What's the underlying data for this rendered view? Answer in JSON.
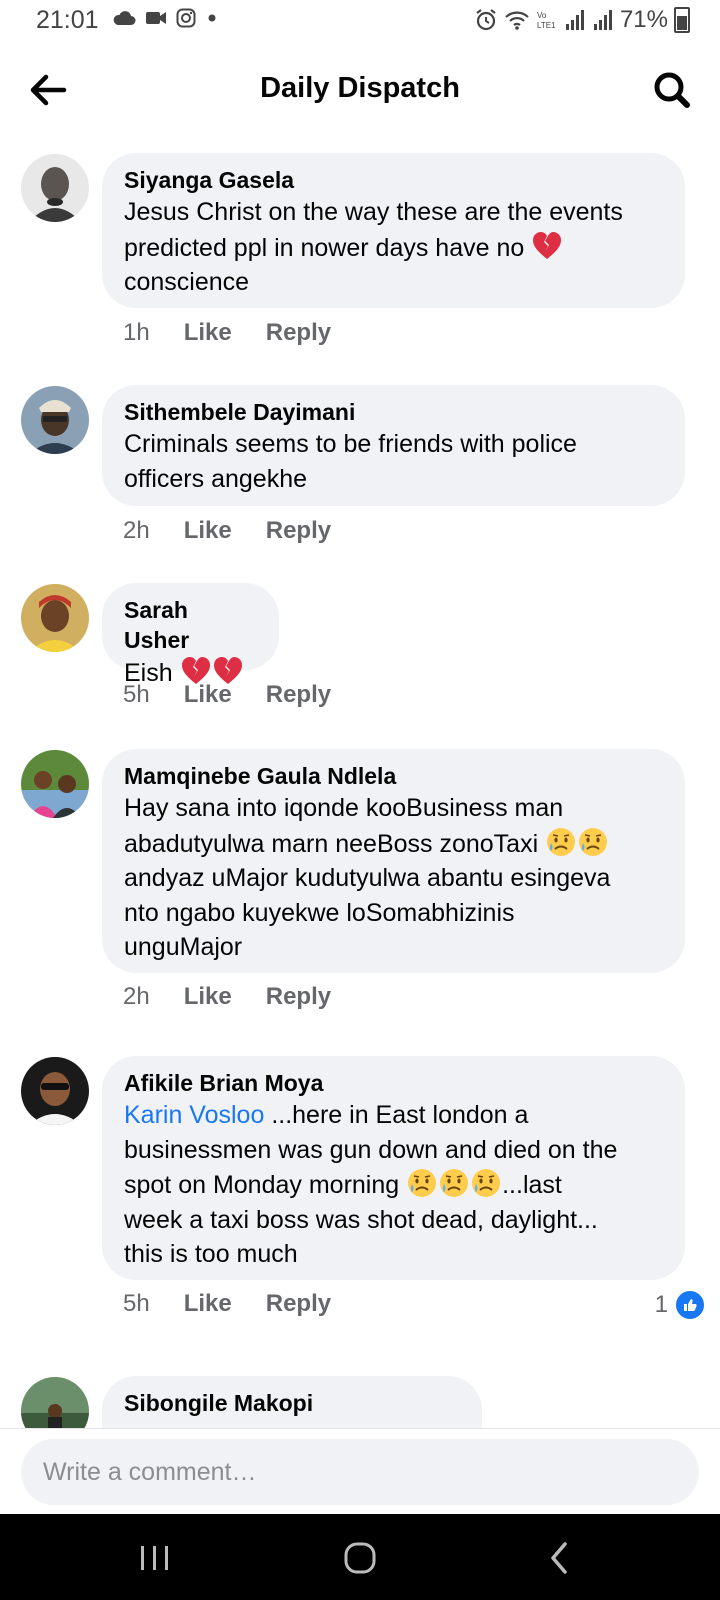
{
  "status_bar": {
    "time": "21:01",
    "battery": "71%",
    "icons_left": [
      "cloud-icon",
      "video-camera-icon",
      "instagram-icon",
      "dot-icon"
    ],
    "icons_right": [
      "alarm-icon",
      "wifi-icon",
      "volte-icon",
      "signal-icon",
      "signal-icon",
      "battery-icon"
    ]
  },
  "header": {
    "title": "Daily Dispatch",
    "back_icon": "arrow-left-icon",
    "search_icon": "search-icon"
  },
  "comments": [
    {
      "author": "Siyanga Gasela",
      "lines": [
        "Jesus Christ on the way these are the events",
        "predicted ppl in nower days have no",
        "conscience"
      ],
      "emoji_after_line2": "broken-heart",
      "time": "1h",
      "like_label": "Like",
      "reply_label": "Reply"
    },
    {
      "author": "Sithembele Dayimani",
      "lines": [
        "Criminals seems to be friends with police",
        "officers angekhe"
      ],
      "time": "2h",
      "like_label": "Like",
      "reply_label": "Reply"
    },
    {
      "author": "Sarah Usher",
      "lines": [
        "Eish"
      ],
      "emoji_after_line1": "broken-heart x2",
      "time": "5h",
      "like_label": "Like",
      "reply_label": "Reply"
    },
    {
      "author": "Mamqinebe Gaula Ndlela",
      "lines": [
        "Hay sana into iqonde kooBusiness man",
        "abadutyulwa marn neeBoss zonoTaxi",
        "andyaz uMajor kudutyulwa abantu esingeva",
        "nto ngabo kuyekwe loSomabhizinis",
        "unguMajor"
      ],
      "emoji_after_line2": "sad-tear x2",
      "time": "2h",
      "like_label": "Like",
      "reply_label": "Reply"
    },
    {
      "author": "Afikile Brian Moya",
      "mention": "Karin Vosloo",
      "lines": [
        " ...here in East london a",
        "businessmen was gun down and died on the",
        "spot on Monday morning ",
        "...last",
        "week a taxi boss was shot dead, daylight...",
        "this is too much"
      ],
      "emoji_in_line3": "sad-tear x3",
      "time": "5h",
      "like_label": "Like",
      "reply_label": "Reply",
      "reaction_count": "1"
    },
    {
      "author": "Sibongile Makopi"
    }
  ],
  "composer": {
    "placeholder": "Write a comment…"
  },
  "nav_bar": {
    "icons": [
      "recent-apps-icon",
      "home-icon",
      "back-icon"
    ]
  },
  "colors": {
    "bubble": "#f0f2f5",
    "link": "#1877f2",
    "secondary_text": "#65676b"
  }
}
